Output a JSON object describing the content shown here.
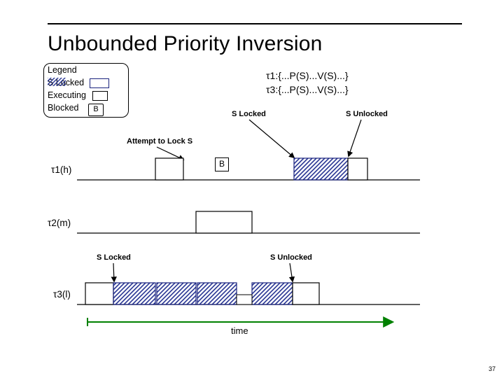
{
  "title": "Unbounded Priority Inversion",
  "legend": {
    "r1": "Legend",
    "r2": "S Locked",
    "r3": "Executing",
    "r4": "Blocked",
    "blocked_badge": "B"
  },
  "defs": {
    "line1": "τ1:{...P(S)...V(S)...}",
    "line2": "τ3:{...P(S)...V(S)...}"
  },
  "labels": {
    "attempt": "Attempt to Lock S",
    "s_locked_top": "S Locked",
    "s_unlocked_top": "S Unlocked",
    "s_locked_bot": "S Locked",
    "s_unlocked_bot": "S Unlocked",
    "time": "time"
  },
  "rows": {
    "t1": "τ1(h)",
    "t2": "τ2(m)",
    "t3": "τ3(l)"
  },
  "blocked_b": "B",
  "page_number": "37",
  "chart_data": {
    "type": "timing-diagram",
    "time_axis": {
      "start": 0,
      "end": 500
    },
    "tasks": [
      {
        "name": "τ1",
        "priority": "h",
        "segments": [
          {
            "state": "executing",
            "start": 160,
            "end": 200
          },
          {
            "state": "blocked",
            "start": 200,
            "end": 363,
            "label": "B"
          },
          {
            "state": "s_locked",
            "start": 363,
            "end": 440
          },
          {
            "state": "executing",
            "start": 440,
            "end": 468
          }
        ],
        "events": [
          {
            "label": "Attempt to Lock S",
            "t": 200
          },
          {
            "label": "S Locked",
            "t": 363
          },
          {
            "label": "S Unlocked",
            "t": 440
          }
        ]
      },
      {
        "name": "τ2",
        "priority": "m",
        "segments": [
          {
            "state": "executing",
            "start": 220,
            "end": 303
          }
        ]
      },
      {
        "name": "τ3",
        "priority": "l",
        "segments": [
          {
            "state": "executing",
            "start": 20,
            "end": 60
          },
          {
            "state": "s_locked",
            "start": 60,
            "end": 160
          },
          {
            "state": "s_locked",
            "start": 303,
            "end": 363
          },
          {
            "state": "executing",
            "start": 363,
            "end": 400
          }
        ],
        "events": [
          {
            "label": "S Locked",
            "t": 60
          },
          {
            "label": "S Unlocked",
            "t": 363
          }
        ]
      }
    ]
  }
}
